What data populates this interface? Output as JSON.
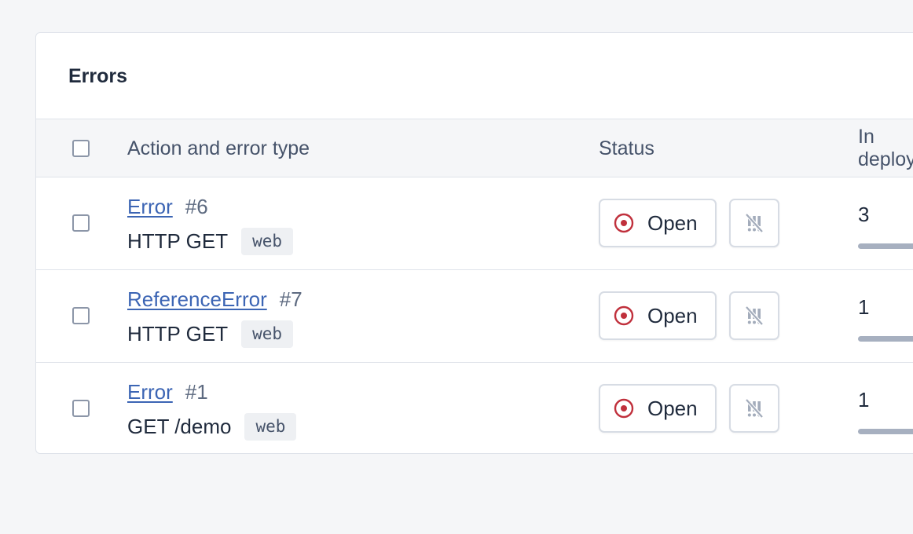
{
  "panel": {
    "title": "Errors"
  },
  "table": {
    "columns": {
      "action": "Action and error type",
      "status": "Status",
      "deploy": "In deploy"
    },
    "rows": [
      {
        "error_type": "Error",
        "number": "#6",
        "action": "HTTP GET",
        "namespace": "web",
        "status": "Open",
        "count": "3"
      },
      {
        "error_type": "ReferenceError",
        "number": "#7",
        "action": "HTTP GET",
        "namespace": "web",
        "status": "Open",
        "count": "1"
      },
      {
        "error_type": "Error",
        "number": "#1",
        "action": "GET /demo",
        "namespace": "web",
        "status": "Open",
        "count": "1"
      }
    ]
  },
  "icons": {
    "status_open": "target-icon",
    "mute": "notifications-off-icon"
  },
  "colors": {
    "link": "#3c65b4",
    "open_icon": "#c0303c"
  }
}
